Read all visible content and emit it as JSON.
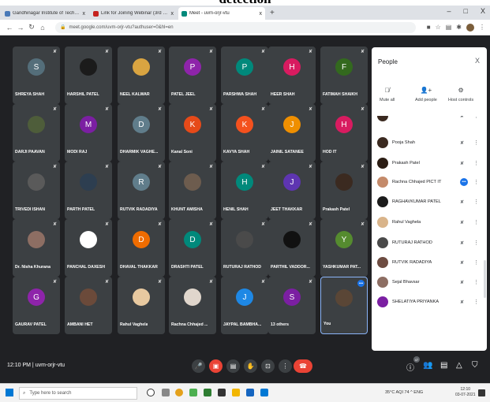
{
  "heading": {
    "text": "detection"
  },
  "browser": {
    "tabs": [
      {
        "label": "Gandhinagar Institute of Technol",
        "close": "x",
        "favicon_color": "#4a7ab8",
        "active": false
      },
      {
        "label": "Link for Joining Webinar (3rd Ju)",
        "close": "x",
        "favicon_color": "#c5221f",
        "active": false
      },
      {
        "label": "Meet - uvm-orjr-vtu",
        "close": "x",
        "favicon_color": "#00897b",
        "active": true
      }
    ],
    "new_tab": "+",
    "window_controls": {
      "minimize": "–",
      "maximize": "□",
      "close": "X"
    },
    "url": "meet.google.com/uvm-orjr-vtu?authuser=0&hl=en"
  },
  "meeting": {
    "participants": [
      {
        "name": "SHREYA SHAH",
        "initial": "S",
        "color": "#546e7a",
        "col": 0,
        "row": 0
      },
      {
        "name": "HARSHIL PATEL",
        "initial": "",
        "color": "#1b1b1b",
        "col": 1,
        "row": 0
      },
      {
        "name": "NEEL KALWAR",
        "initial": "",
        "color": "#d9a441",
        "col": 2,
        "row": 0
      },
      {
        "name": "PATEL JEEL",
        "initial": "P",
        "color": "#8e24aa",
        "col": 3,
        "row": 0
      },
      {
        "name": "PARSHWA SHAH",
        "initial": "P",
        "color": "#00897b",
        "col": 4,
        "row": 0
      },
      {
        "name": "HEER SHAH",
        "initial": "H",
        "color": "#d81b60",
        "col": 5,
        "row": 0
      },
      {
        "name": "FATIMAH SHAIKH",
        "initial": "F",
        "color": "#33691e",
        "col": 6,
        "row": 0
      },
      {
        "name": "DARJI PAAVAN",
        "initial": "",
        "color": "#4e5d3a",
        "col": 0,
        "row": 1
      },
      {
        "name": "MODI RAJ",
        "initial": "M",
        "color": "#7b1fa2",
        "col": 1,
        "row": 1
      },
      {
        "name": "DHARMIK VAGHE...",
        "initial": "D",
        "color": "#607d8b",
        "col": 2,
        "row": 1
      },
      {
        "name": "Kanal Soni",
        "initial": "K",
        "color": "#e64a19",
        "col": 3,
        "row": 1
      },
      {
        "name": "KAVYA SHAH",
        "initial": "K",
        "color": "#f4511e",
        "col": 4,
        "row": 1
      },
      {
        "name": "JAINIL SATANEE",
        "initial": "J",
        "color": "#ef8f00",
        "col": 5,
        "row": 1
      },
      {
        "name": "HOD IT",
        "initial": "H",
        "color": "#d81b60",
        "col": 6,
        "row": 1
      },
      {
        "name": "TRIVEDI ISHAN",
        "initial": "",
        "color": "#5a5a5a",
        "col": 0,
        "row": 2
      },
      {
        "name": "PARTH PATEL",
        "initial": "",
        "color": "#2d3e50",
        "col": 1,
        "row": 2
      },
      {
        "name": "RUTVIK RADADIYA",
        "initial": "R",
        "color": "#607d8b",
        "col": 2,
        "row": 2
      },
      {
        "name": "KHUNT AMISHA",
        "initial": "",
        "color": "#6d5c4e",
        "col": 3,
        "row": 2
      },
      {
        "name": "HENIL SHAH",
        "initial": "H",
        "color": "#00897b",
        "col": 4,
        "row": 2
      },
      {
        "name": "JEET THAKKAR",
        "initial": "J",
        "color": "#5e35b1",
        "col": 5,
        "row": 2
      },
      {
        "name": "Prakash Patel",
        "initial": "",
        "color": "#3b2a20",
        "col": 6,
        "row": 2
      },
      {
        "name": "Dr. Nisha Khurana",
        "initial": "",
        "color": "#8d6e63",
        "col": 0,
        "row": 3
      },
      {
        "name": "PANCHAL DAXESH",
        "initial": "",
        "color": "#ffffff",
        "col": 1,
        "row": 3
      },
      {
        "name": "DHAVAL THAKKAR",
        "initial": "D",
        "color": "#ef6c00",
        "col": 2,
        "row": 3
      },
      {
        "name": "DRASHTI PATEL",
        "initial": "D",
        "color": "#00897b",
        "col": 3,
        "row": 3
      },
      {
        "name": "RUTURAJ RATHOD",
        "initial": "",
        "color": "#4a4a4a",
        "col": 4,
        "row": 3
      },
      {
        "name": "PARTHIL VADDOR...",
        "initial": "",
        "color": "#111111",
        "col": 5,
        "row": 3
      },
      {
        "name": "YASHKUMAR PAT...",
        "initial": "Y",
        "color": "#558b2f",
        "col": 6,
        "row": 3
      },
      {
        "name": "GAURAV PATEL",
        "initial": "G",
        "color": "#8e24aa",
        "col": 0,
        "row": 4
      },
      {
        "name": "AMBANI HET",
        "initial": "",
        "color": "#6b4a3a",
        "col": 1,
        "row": 4
      },
      {
        "name": "Rahul Vaghela",
        "initial": "",
        "color": "#e8c9a0",
        "col": 2,
        "row": 4
      },
      {
        "name": "Rachna Chhajed ...",
        "initial": "",
        "color": "#e0d6cc",
        "col": 3,
        "row": 4
      },
      {
        "name": "JAYPAL BAMBHA...",
        "initial": "J",
        "color": "#1e88e5",
        "col": 4,
        "row": 4
      },
      {
        "name": "13 others",
        "initial": "S",
        "color": "#7b1fa2",
        "col": 5,
        "row": 4
      },
      {
        "name": "You",
        "initial": "",
        "color": "#5a4636",
        "col": 6,
        "row": 4
      }
    ],
    "you_more": "•••",
    "time": "12:10 PM",
    "separator": "|",
    "code": "uvm-orjr-vtu",
    "people_count": "47"
  },
  "people_panel": {
    "title": "People",
    "close": "X",
    "actions": [
      {
        "label": "Mute all",
        "icon": "mic-off-icon"
      },
      {
        "label": "Add people",
        "icon": "add-person-icon"
      },
      {
        "label": "Host controls",
        "icon": "host-controls-icon"
      }
    ],
    "list": [
      {
        "name": "",
        "avatar": "#3b2a20"
      },
      {
        "name": "Pooja Shah",
        "avatar": "#3b2a20"
      },
      {
        "name": "Prakash Patel",
        "avatar": "#2b1d14"
      },
      {
        "name": "Rachna Chhajed PICT IT",
        "avatar": "#c48a6a",
        "speaking": true
      },
      {
        "name": "RAGHAVKUMAR PATEL",
        "avatar": "#1b1b1b"
      },
      {
        "name": "Rahul Vaghela",
        "avatar": "#d9b48a"
      },
      {
        "name": "RUTURAJ RATHOD",
        "avatar": "#4a4a4a"
      },
      {
        "name": "RUTVIK RADADIYA",
        "avatar": "#6d4c41"
      },
      {
        "name": "Sejal Bhavsar",
        "avatar": "#8d6e63"
      },
      {
        "name": "SHELATIYA PRIYANKA",
        "avatar": "#7b1fa2"
      }
    ]
  },
  "taskbar": {
    "search_placeholder": "Type here to search",
    "tray": "35°C AQI 74  ^  ENG",
    "time": "12:10",
    "date": "03-07-2021"
  }
}
